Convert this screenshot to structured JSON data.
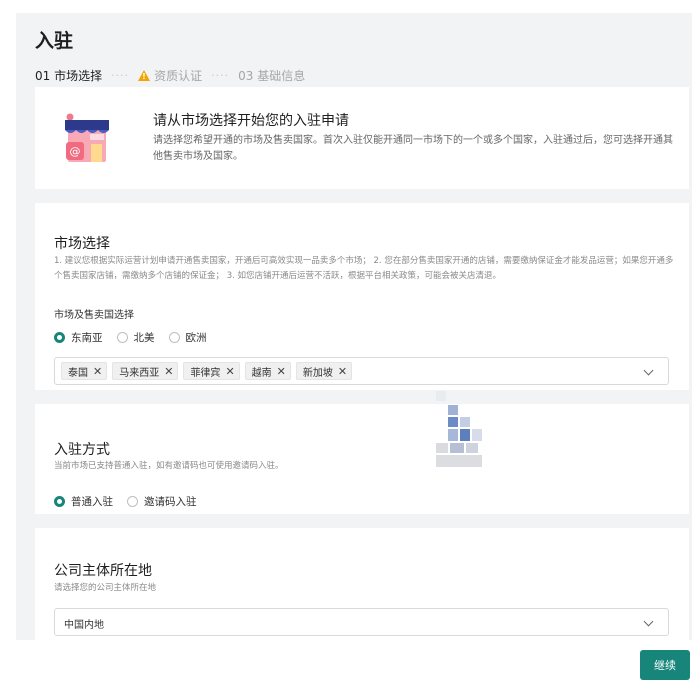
{
  "page": {
    "title": "入驻",
    "steps": [
      "01 市场选择",
      "资质认证",
      "03 基础信息"
    ]
  },
  "intro": {
    "title": "请从市场选择开始您的入驻申请",
    "desc": "请选择您希望开通的市场及售卖国家。首次入驻仅能开通同一市场下的一个或多个国家，入驻通过后，您可选择开通其他售卖市场及国家。"
  },
  "market": {
    "title": "市场选择",
    "desc": "1. 建议您根据实际运营计划申请开通售卖国家，开通后可高效实现一品卖多个市场； 2. 您在部分售卖国家开通的店铺，需要缴纳保证金才能发品运营；如果您开通多个售卖国家店铺，需缴纳多个店铺的保证金； 3. 如您店铺开通后运营不活跃，根据平台相关政策，可能会被关店清退。",
    "field_label": "市场及售卖国选择",
    "regions": [
      {
        "label": "东南亚",
        "selected": true
      },
      {
        "label": "北美",
        "selected": false
      },
      {
        "label": "欧洲",
        "selected": false
      }
    ],
    "countries": [
      "泰国",
      "马来西亚",
      "菲律宾",
      "越南",
      "新加坡"
    ]
  },
  "join_method": {
    "title": "入驻方式",
    "desc": "当前市场已支持普通入驻，如有邀请码也可使用邀请码入驻。",
    "options": [
      {
        "label": "普通入驻",
        "selected": true
      },
      {
        "label": "邀请码入驻",
        "selected": false
      }
    ]
  },
  "company": {
    "title": "公司主体所在地",
    "desc": "请选择您的公司主体所在地",
    "value": "中国内地"
  },
  "footer": {
    "continue_label": "继续"
  },
  "colors": {
    "accent": "#17857a",
    "warning": "#f0a500"
  }
}
